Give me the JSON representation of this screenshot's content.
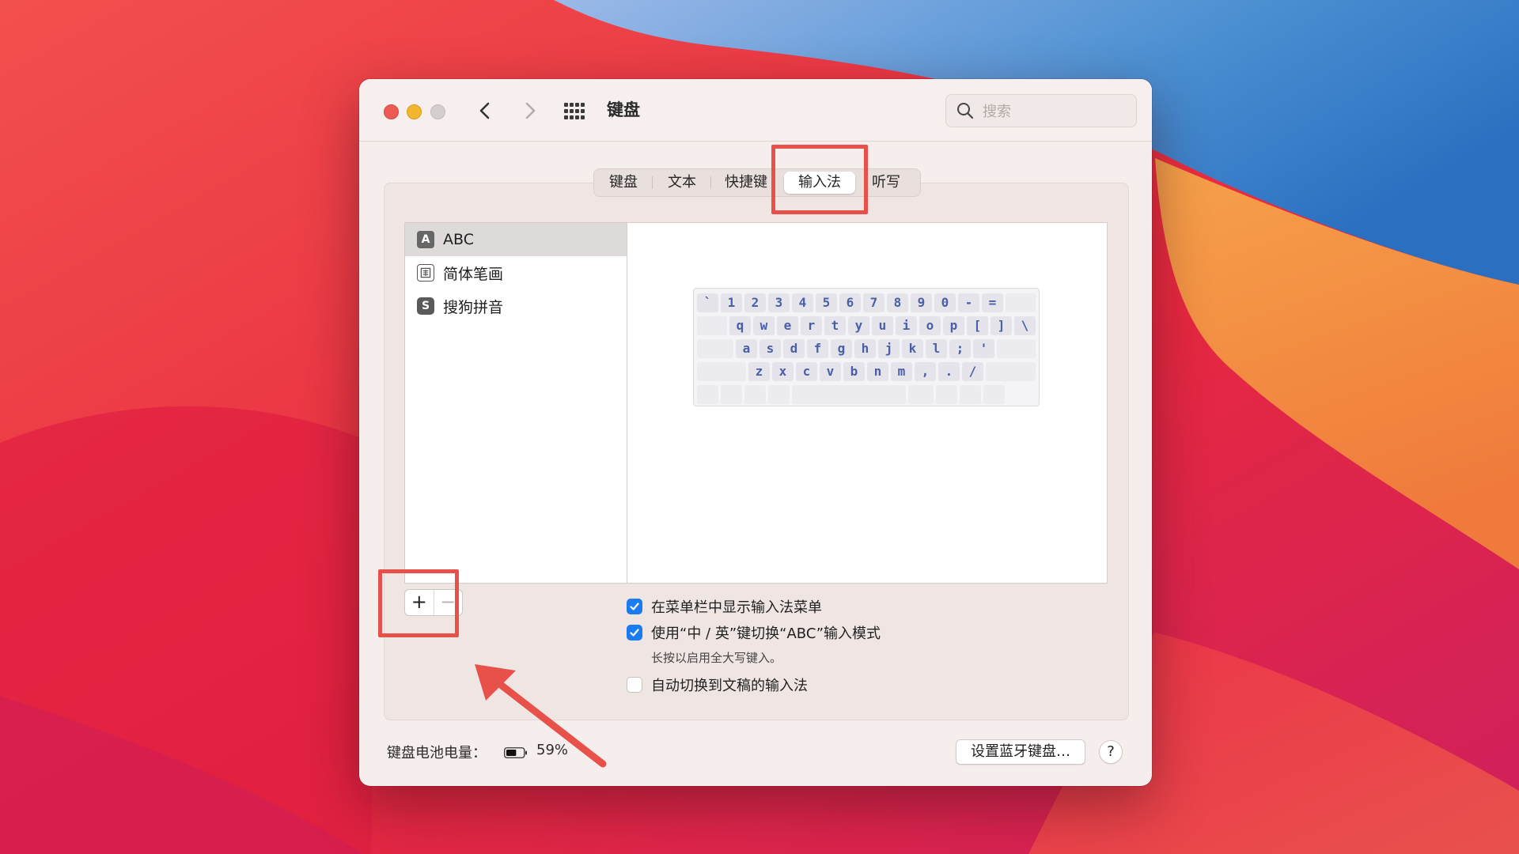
{
  "window": {
    "title": "键盘",
    "search_placeholder": "搜索"
  },
  "tabs": [
    "键盘",
    "文本",
    "快捷键",
    "输入法",
    "听写"
  ],
  "active_tab": "输入法",
  "input_sources": [
    {
      "label": "ABC",
      "icon": "abc-icon",
      "glyph": "A",
      "selected": true
    },
    {
      "label": "简体笔画",
      "icon": "stroke-icon",
      "glyph": "画",
      "selected": false
    },
    {
      "label": "搜狗拼音",
      "icon": "sogou-icon",
      "glyph": "S",
      "selected": false
    }
  ],
  "keyboard_rows": [
    [
      "`",
      "1",
      "2",
      "3",
      "4",
      "5",
      "6",
      "7",
      "8",
      "9",
      "0",
      "-",
      "=",
      ""
    ],
    [
      "",
      "q",
      "w",
      "e",
      "r",
      "t",
      "y",
      "u",
      "i",
      "o",
      "p",
      "[",
      "]",
      "\\"
    ],
    [
      "",
      "a",
      "s",
      "d",
      "f",
      "g",
      "h",
      "j",
      "k",
      "l",
      ";",
      "'",
      ""
    ],
    [
      "",
      "z",
      "x",
      "c",
      "v",
      "b",
      "n",
      "m",
      ",",
      ".",
      "/",
      ""
    ]
  ],
  "list_controls": {
    "add": "+",
    "remove": "−"
  },
  "options": [
    {
      "label": "在菜单栏中显示输入法菜单",
      "checked": true
    },
    {
      "label": "使用“中 / 英”键切换“ABC”输入模式",
      "checked": true
    },
    {
      "label": "自动切换到文稿的输入法",
      "checked": false
    }
  ],
  "option_hint": "长按以启用全大写键入。",
  "footer": {
    "battery_label": "键盘电池电量：",
    "battery_percent": "59%",
    "battery_level": 0.59,
    "bluetooth_button": "设置蓝牙键盘…",
    "help": "?"
  },
  "colors": {
    "accent": "#1a7cf0",
    "highlight": "#e8514a",
    "window_bg": "#f6eeec"
  }
}
